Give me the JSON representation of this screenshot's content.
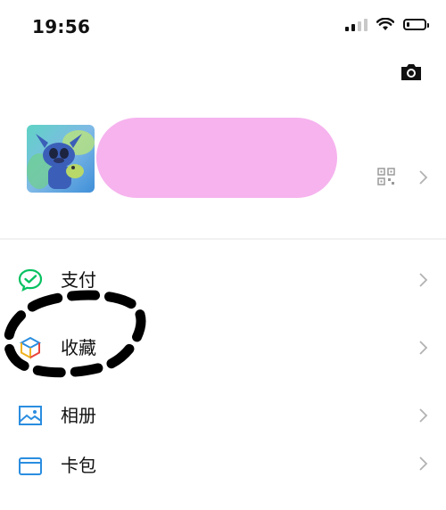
{
  "status_bar": {
    "time": "19:56"
  },
  "colors": {
    "redaction": "#f6b3ee",
    "accent_green": "#07c160",
    "icon_blue": "#2a8de0",
    "chevron": "#b2b2b2"
  },
  "menu": {
    "items": [
      {
        "label": "支付",
        "icon": "wechat-pay-icon"
      },
      {
        "label": "收藏",
        "icon": "favorites-cube-icon"
      },
      {
        "label": "相册",
        "icon": "album-icon"
      },
      {
        "label": "卡包",
        "icon": "card-wallet-icon"
      }
    ]
  }
}
